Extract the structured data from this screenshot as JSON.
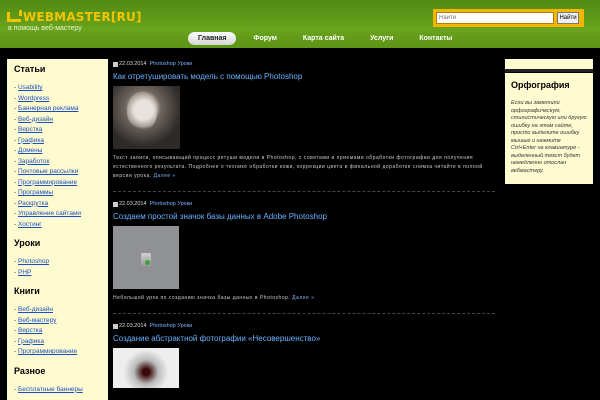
{
  "header": {
    "logo": "WEBMASTER[RU]",
    "tagline": "в помощь веб-мастеру",
    "search": {
      "placeholder": "Найти",
      "button": "Найти"
    },
    "nav": [
      {
        "label": "Главная",
        "active": true
      },
      {
        "label": "Форум",
        "active": false
      },
      {
        "label": "Карта сайта",
        "active": false
      },
      {
        "label": "Услуги",
        "active": false
      },
      {
        "label": "Контакты",
        "active": false
      }
    ]
  },
  "sidebar": {
    "sections": [
      {
        "title": "Статьи",
        "items": [
          "Usability",
          "Wordpress",
          "Баннерная реклама",
          "Веб-дизайн",
          "Верстка",
          "Графика",
          "Домены",
          "Заработок",
          "Почтовые рассылки",
          "Программирование",
          "Программы",
          "Раскрутка",
          "Управление сайтами",
          "Хостинг"
        ]
      },
      {
        "title": "Уроки",
        "items": [
          "Photoshop",
          "PHP"
        ]
      },
      {
        "title": "Книги",
        "items": [
          "Веб-дизайн",
          "Веб-мастеру",
          "Верстка",
          "Графика",
          "Программирование"
        ]
      },
      {
        "title": "Разное",
        "items": [
          "Бесплатные баннеры"
        ]
      }
    ]
  },
  "posts": [
    {
      "date": "22.03.2014",
      "category": "Photoshop Уроки",
      "title": "Как отретушировать модель с помощью Photoshop",
      "excerpt": "Текст записи, описывающий процесс ретуши модели в Photoshop, с советами и приемами обработки фотографии для получения естественного результата. Подробнее о технике обработки кожи, коррекции цвета и финальной доработке снимка читайте в полной версии урока.",
      "more": "Далее »"
    },
    {
      "date": "22.03.2014",
      "category": "Photoshop Уроки",
      "title": "Создаем простой значок базы данных в Adobe Photoshop",
      "excerpt": "Небольшой урок по созданию значка базы данных в Photoshop.",
      "more": "Далее »"
    },
    {
      "date": "22.03.2014",
      "category": "Photoshop Уроки",
      "title": "Создание абстрактной фотографии «Несовершенство»",
      "excerpt": "",
      "more": ""
    }
  ],
  "right": {
    "title": "Орфография",
    "text": "Если вы заметили орфографическую, стилистическую или другую ошибку на этом сайте, просто выделите ошибку мышью и нажмите Ctrl+Enter на клавиатуре - выделенный текст будет немедленно отослан вебмастеру."
  },
  "colors": {
    "header_green": "#6aa31c",
    "logo_yellow": "#f5c400",
    "link_blue": "#6ab2ff",
    "sidebar_bg": "#fffbd0"
  }
}
